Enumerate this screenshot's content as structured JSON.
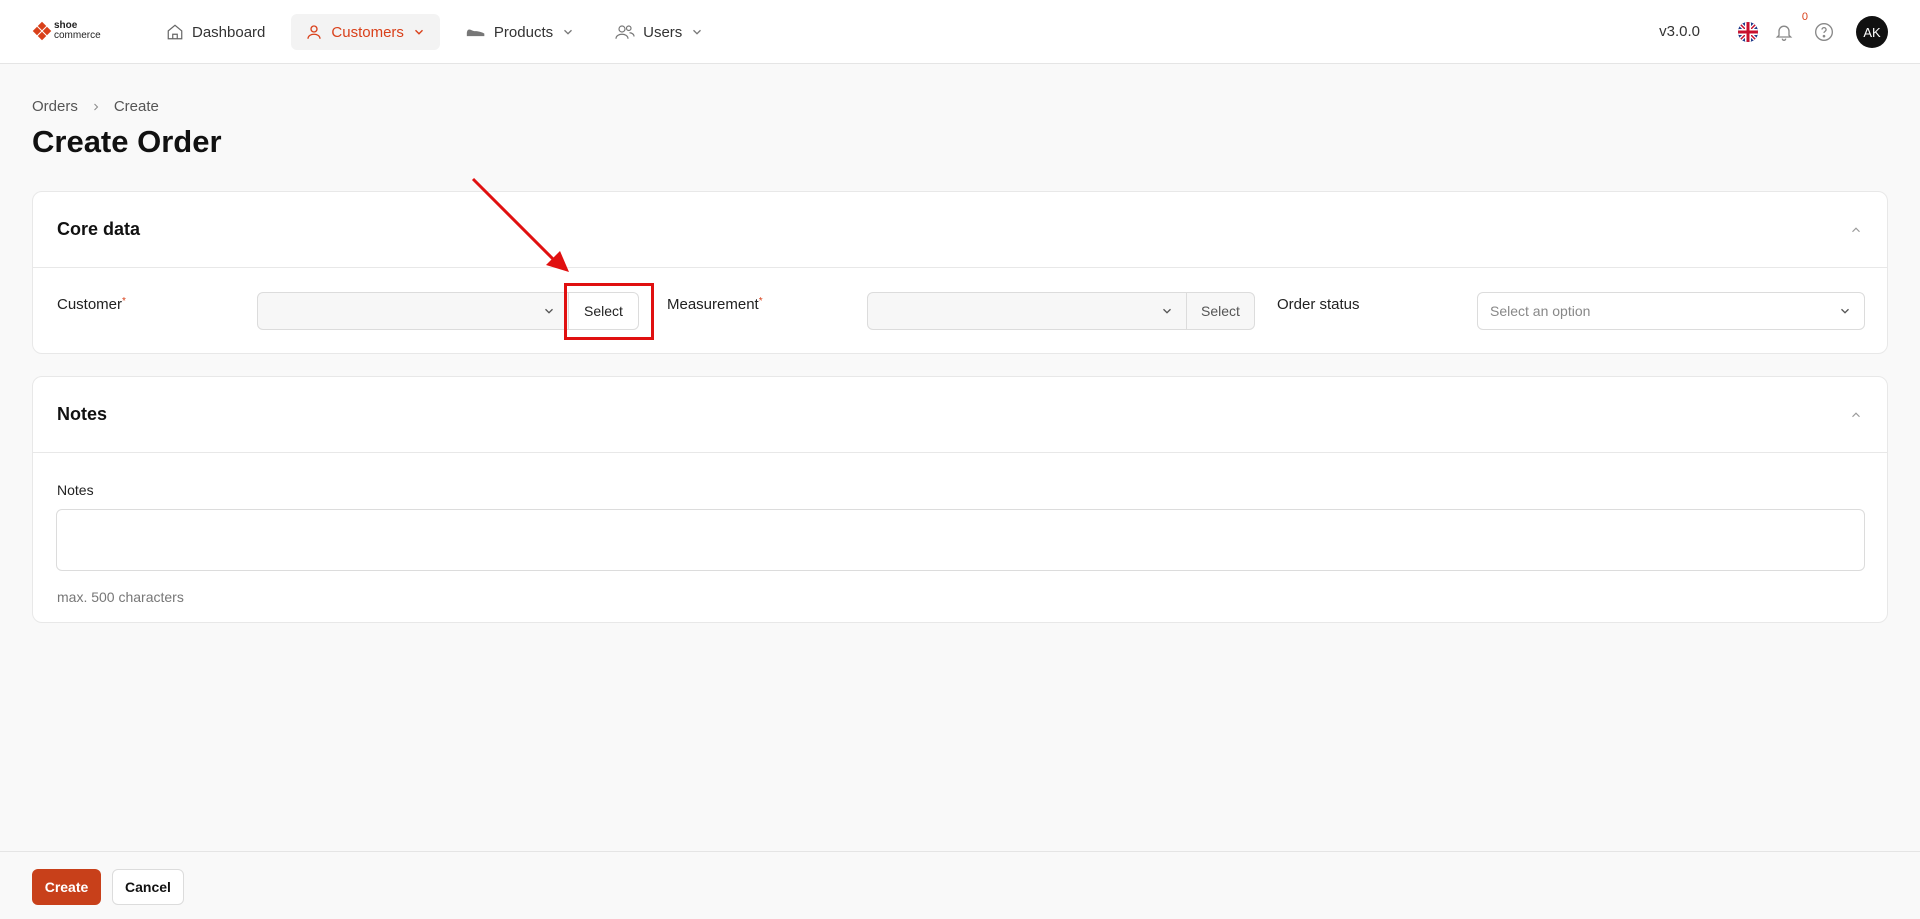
{
  "logo": {
    "line1": "shoe",
    "line2": "commerce"
  },
  "nav": {
    "items": [
      {
        "label": "Dashboard",
        "icon": "home-icon"
      },
      {
        "label": "Customers",
        "icon": "user-icon"
      },
      {
        "label": "Products",
        "icon": "shoe-icon"
      },
      {
        "label": "Users",
        "icon": "users-icon"
      }
    ],
    "active": "Customers"
  },
  "header": {
    "version": "v3.0.0",
    "notification_count": "0",
    "avatar_initials": "AK"
  },
  "breadcrumb": {
    "items": [
      "Orders",
      "Create"
    ]
  },
  "page": {
    "title": "Create Order"
  },
  "core_data": {
    "title": "Core data",
    "customer_label": "Customer",
    "customer_select_button": "Select",
    "measurement_label": "Measurement",
    "measurement_select_button": "Select",
    "order_status_label": "Order status",
    "order_status_placeholder": "Select an option",
    "required_mark": "*"
  },
  "notes": {
    "title": "Notes",
    "field_label": "Notes",
    "hint": "max. 500 characters"
  },
  "footer": {
    "create_label": "Create",
    "cancel_label": "Cancel"
  },
  "colors": {
    "accent": "#c8401a",
    "annotation": "#e01010"
  }
}
